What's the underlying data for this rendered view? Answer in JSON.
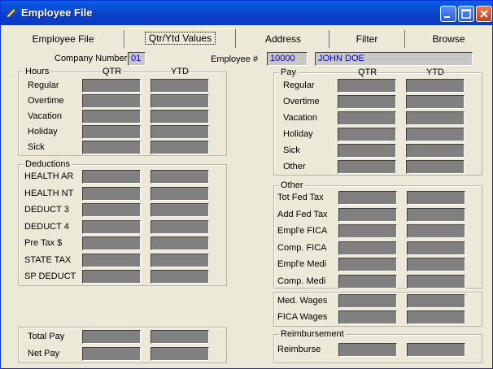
{
  "window": {
    "title": "Employee File"
  },
  "tabs": [
    "Employee File",
    "Qtr/Ytd Values",
    "Address",
    "Filter",
    "Browse"
  ],
  "header": {
    "company_label": "Company Number",
    "company_value": "01",
    "employee_label": "Employee #",
    "employee_value": "10000",
    "employee_name": "JOHN DOE"
  },
  "col_headers": {
    "qtr": "QTR",
    "ytd": "YTD"
  },
  "hours": {
    "title": "Hours",
    "rows": [
      "Regular",
      "Overtime",
      "Vacation",
      "Holiday",
      "Sick"
    ]
  },
  "deductions": {
    "title": "Deductions",
    "rows": [
      "HEALTH AR",
      "HEALTH NT",
      "DEDUCT 3",
      "DEDUCT 4",
      "Pre Tax $",
      "STATE TAX",
      "SP DEDUCT"
    ]
  },
  "totals": {
    "rows": [
      "Total Pay",
      "Net Pay"
    ]
  },
  "pay": {
    "title": "Pay",
    "rows": [
      "Regular",
      "Overtime",
      "Vacation",
      "Holiday",
      "Sick",
      "Other"
    ]
  },
  "other": {
    "title": "Other",
    "rows": [
      "Tot Fed Tax",
      "Add Fed Tax",
      "Empl'e FICA",
      "Comp. FICA",
      "Empl'e Medi",
      "Comp. Medi"
    ]
  },
  "wages": {
    "rows": [
      "Med. Wages",
      "FICA Wages"
    ]
  },
  "reimbursement": {
    "title": "Reimbursement",
    "rows": [
      "Reimburse"
    ]
  }
}
